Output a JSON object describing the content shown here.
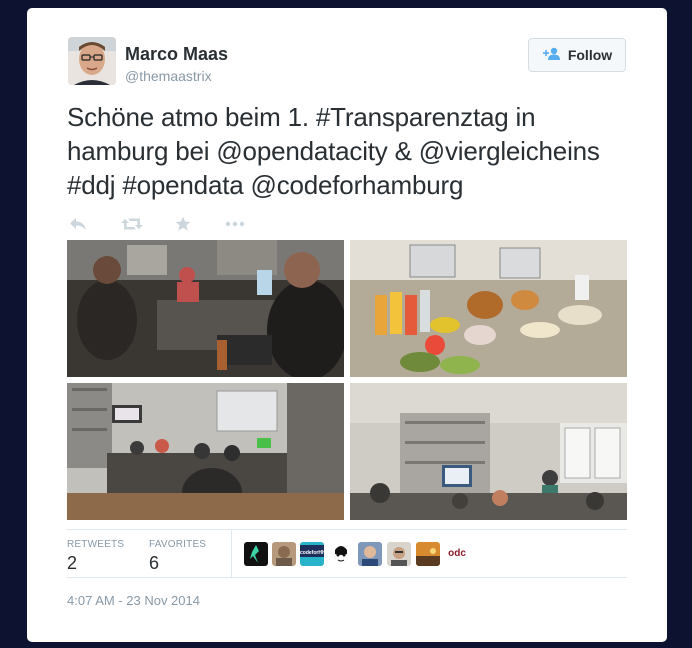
{
  "tweet": {
    "author_name": "Marco Maas",
    "author_handle": "@themaastrix",
    "follow_label": "Follow",
    "text_line1": "Schöne atmo beim 1. #Transparenztag in",
    "text_line2": "hamburg bei @opendatacity & @viergleicheins",
    "text_line3": "#ddj #opendata @codeforhamburg",
    "timestamp": "4:07 AM - 23 Nov 2014"
  },
  "stats": {
    "retweets_label": "RETWEETS",
    "retweets_count": "2",
    "favorites_label": "FAVORITES",
    "favorites_count": "6"
  },
  "favoriters": [
    {
      "name": "favoriter-1",
      "label": ""
    },
    {
      "name": "favoriter-2",
      "label": ""
    },
    {
      "name": "favoriter-3",
      "label": "codeforHH"
    },
    {
      "name": "favoriter-4",
      "label": ""
    },
    {
      "name": "favoriter-5",
      "label": ""
    },
    {
      "name": "favoriter-6",
      "label": ""
    },
    {
      "name": "favoriter-7",
      "label": ""
    },
    {
      "name": "favoriter-8",
      "label": "ODC"
    }
  ],
  "icons": [
    "reply-icon",
    "retweet-icon",
    "favorite-icon",
    "more-icon",
    "follow-user-icon"
  ],
  "colors": {
    "accent": "#55acee",
    "background": "#0d1230",
    "text": "#292f33",
    "muted": "#8899a6",
    "odc": "#8b1d2c"
  }
}
